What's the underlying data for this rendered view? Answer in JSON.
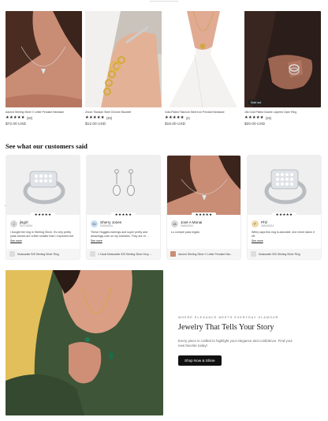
{
  "products": [
    {
      "name": "Adored Sterling Silver V Letter Pendant Necklace",
      "stars": "★★★★★",
      "reviews": "(30)",
      "price": "$72.00 USD"
    },
    {
      "name": "Zircon Titanium Steel Chrome Bracelet",
      "stars": "★★★★★",
      "reviews": "(45)",
      "price": "$12.00 USD"
    },
    {
      "name": "Gold-Plated Titanium Steel Iron Pendant Necklace",
      "stars": "★★★★★",
      "reviews": "(4)",
      "price": "$15.00 USD"
    },
    {
      "name": "18k Gold Plated Double Layered Open Ring",
      "stars": "★★★★★",
      "reviews": "(26)",
      "price": "$20.00 USD",
      "badge": "Sold out"
    }
  ],
  "section_title": "See what our customers said",
  "nav": {
    "prev": "‹",
    "next": "›"
  },
  "reviews": [
    {
      "initial": "J",
      "name": "jlsgirl",
      "date": "02/17/2024",
      "stars": "★★★★★",
      "text": "I bought the ring in Sterling Silver. It’s very pretty (side stones are a little smaller than I expected but ...",
      "see_more": "See more",
      "product": "Moissanite 925 Sterling Silver Ring"
    },
    {
      "initial": "SJ",
      "name": "Sherry Jones",
      "date": "02/06/2024",
      "stars": "★★★★★",
      "text": "These Huggies earrings and super pretty and amazingly cute on my earlobes. They are of ...",
      "see_more": "See more",
      "product": "1 Carat Moissanite 925 Sterling Silver Drop ..."
    },
    {
      "initial": "JA",
      "name": "José A Monai",
      "date": "03/06/2024",
      "stars": "★★★★★",
      "text": "Lo compré para regalo",
      "see_more": "",
      "product": "Adored Sterling Silver V Letter Pendant Nec..."
    },
    {
      "initial": "P",
      "name": "Phil",
      "date": "03/04/2024",
      "stars": "★★★★★",
      "text": "Wifey says this ring is adorable, she never takes it off.",
      "see_more": "See more",
      "product": "Moissanite 925 Sterling Silver Ring"
    }
  ],
  "banner": {
    "eyebrow": "WHERE ELEGANCE MEETS EVERYDAY GLAMOUR",
    "headline": "Jewelry That Tells Your Story",
    "description": "Every piece is crafted to highlight your elegance and confidence. Find your new favorite today!",
    "cta": "Shop Now & Shine"
  },
  "colors": {
    "accent": "#111111",
    "skin": "#d99e84",
    "blouse": "#3e5537",
    "banner_bg": "#e2bf5b"
  }
}
